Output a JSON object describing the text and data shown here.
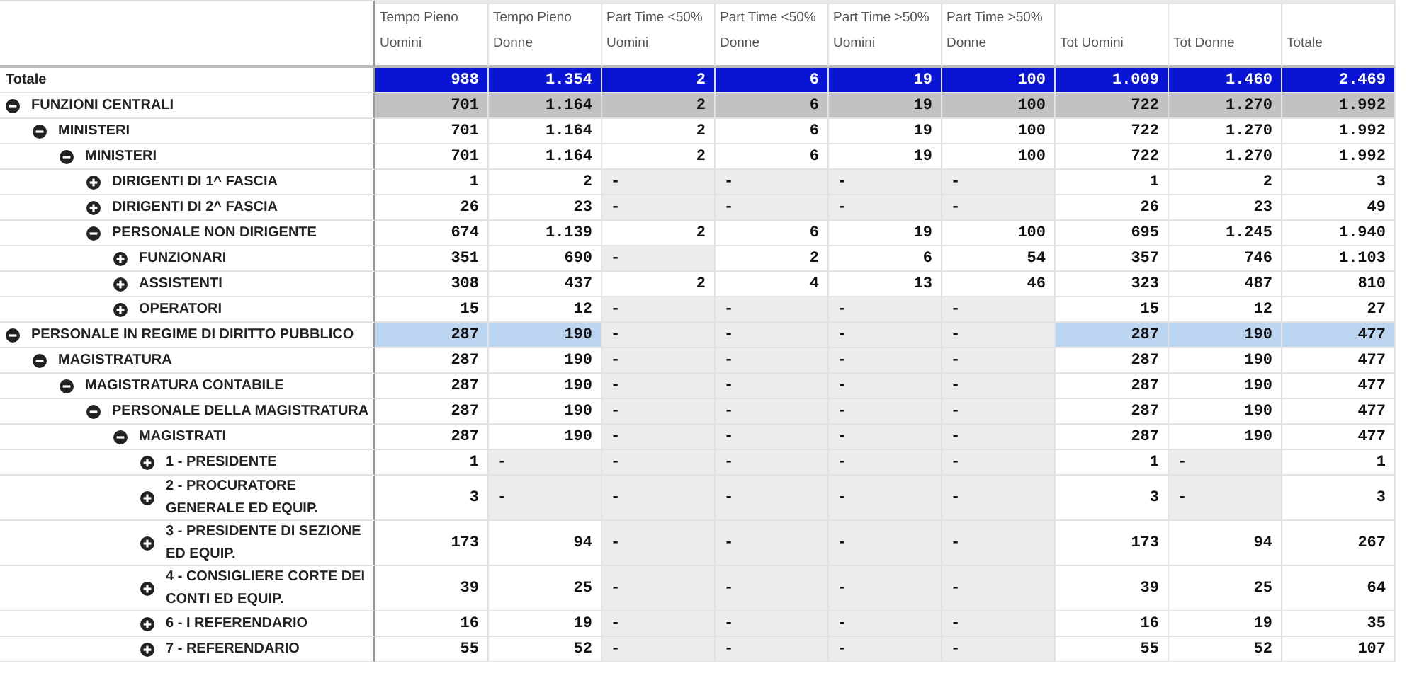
{
  "columns": [
    "Tempo Pieno Uomini",
    "Tempo Pieno Donne",
    "Part Time <50% Uomini",
    "Part Time <50% Donne",
    "Part Time >50% Uomini",
    "Part Time >50% Donne",
    "Tot Uomini",
    "Tot Donne",
    "Totale"
  ],
  "total_row": {
    "label": "Totale",
    "color": "#0a14d4",
    "values": [
      "988",
      "1.354",
      "2",
      "6",
      "19",
      "100",
      "1.009",
      "1.460",
      "2.469"
    ]
  },
  "rows": [
    {
      "label": "FUNZIONI CENTRALI",
      "expanded": true,
      "color": "#c2c2c2",
      "values": [
        "701",
        "1.164",
        "2",
        "6",
        "19",
        "100",
        "722",
        "1.270",
        "1.992"
      ],
      "children": [
        {
          "label": "MINISTERI",
          "expanded": true,
          "values": [
            "701",
            "1.164",
            "2",
            "6",
            "19",
            "100",
            "722",
            "1.270",
            "1.992"
          ],
          "children": [
            {
              "label": "MINISTERI",
              "expanded": true,
              "values": [
                "701",
                "1.164",
                "2",
                "6",
                "19",
                "100",
                "722",
                "1.270",
                "1.992"
              ],
              "children": [
                {
                  "label": "DIRIGENTI DI 1^ FASCIA",
                  "expanded": false,
                  "values": [
                    "1",
                    "2",
                    "-",
                    "-",
                    "-",
                    "-",
                    "1",
                    "2",
                    "3"
                  ]
                },
                {
                  "label": "DIRIGENTI DI 2^ FASCIA",
                  "expanded": false,
                  "values": [
                    "26",
                    "23",
                    "-",
                    "-",
                    "-",
                    "-",
                    "26",
                    "23",
                    "49"
                  ]
                },
                {
                  "label": "PERSONALE NON DIRIGENTE",
                  "expanded": true,
                  "values": [
                    "674",
                    "1.139",
                    "2",
                    "6",
                    "19",
                    "100",
                    "695",
                    "1.245",
                    "1.940"
                  ],
                  "children": [
                    {
                      "label": "FUNZIONARI",
                      "expanded": false,
                      "values": [
                        "351",
                        "690",
                        "-",
                        "2",
                        "6",
                        "54",
                        "357",
                        "746",
                        "1.103"
                      ]
                    },
                    {
                      "label": "ASSISTENTI",
                      "expanded": false,
                      "values": [
                        "308",
                        "437",
                        "2",
                        "4",
                        "13",
                        "46",
                        "323",
                        "487",
                        "810"
                      ]
                    },
                    {
                      "label": "OPERATORI",
                      "expanded": false,
                      "values": [
                        "15",
                        "12",
                        "-",
                        "-",
                        "-",
                        "-",
                        "15",
                        "12",
                        "27"
                      ]
                    }
                  ]
                }
              ]
            }
          ]
        }
      ]
    },
    {
      "label": "PERSONALE IN REGIME DI DIRITTO PUBBLICO",
      "expanded": true,
      "color": "#bcd6f2",
      "values": [
        "287",
        "190",
        "-",
        "-",
        "-",
        "-",
        "287",
        "190",
        "477"
      ],
      "children": [
        {
          "label": "MAGISTRATURA",
          "expanded": true,
          "values": [
            "287",
            "190",
            "-",
            "-",
            "-",
            "-",
            "287",
            "190",
            "477"
          ],
          "children": [
            {
              "label": "MAGISTRATURA CONTABILE",
              "expanded": true,
              "values": [
                "287",
                "190",
                "-",
                "-",
                "-",
                "-",
                "287",
                "190",
                "477"
              ],
              "children": [
                {
                  "label": "PERSONALE DELLA MAGISTRATURA",
                  "expanded": true,
                  "values": [
                    "287",
                    "190",
                    "-",
                    "-",
                    "-",
                    "-",
                    "287",
                    "190",
                    "477"
                  ],
                  "children": [
                    {
                      "label": "MAGISTRATI",
                      "expanded": true,
                      "values": [
                        "287",
                        "190",
                        "-",
                        "-",
                        "-",
                        "-",
                        "287",
                        "190",
                        "477"
                      ],
                      "children": [
                        {
                          "label": "1 - PRESIDENTE",
                          "expanded": false,
                          "values": [
                            "1",
                            "-",
                            "-",
                            "-",
                            "-",
                            "-",
                            "1",
                            "-",
                            "1"
                          ]
                        },
                        {
                          "label": "2 - PROCURATORE GENERALE ED EQUIP.",
                          "expanded": false,
                          "values": [
                            "3",
                            "-",
                            "-",
                            "-",
                            "-",
                            "-",
                            "3",
                            "-",
                            "3"
                          ]
                        },
                        {
                          "label": "3 - PRESIDENTE DI SEZIONE ED EQUIP.",
                          "expanded": false,
                          "values": [
                            "173",
                            "94",
                            "-",
                            "-",
                            "-",
                            "-",
                            "173",
                            "94",
                            "267"
                          ]
                        },
                        {
                          "label": "4 - CONSIGLIERE CORTE DEI CONTI ED EQUIP.",
                          "expanded": false,
                          "values": [
                            "39",
                            "25",
                            "-",
                            "-",
                            "-",
                            "-",
                            "39",
                            "25",
                            "64"
                          ]
                        },
                        {
                          "label": "6 - I REFERENDARIO",
                          "expanded": false,
                          "values": [
                            "16",
                            "19",
                            "-",
                            "-",
                            "-",
                            "-",
                            "16",
                            "19",
                            "35"
                          ]
                        },
                        {
                          "label": "7 - REFERENDARIO",
                          "expanded": false,
                          "values": [
                            "55",
                            "52",
                            "-",
                            "-",
                            "-",
                            "-",
                            "55",
                            "52",
                            "107"
                          ]
                        }
                      ]
                    }
                  ]
                }
              ]
            }
          ]
        }
      ]
    }
  ]
}
